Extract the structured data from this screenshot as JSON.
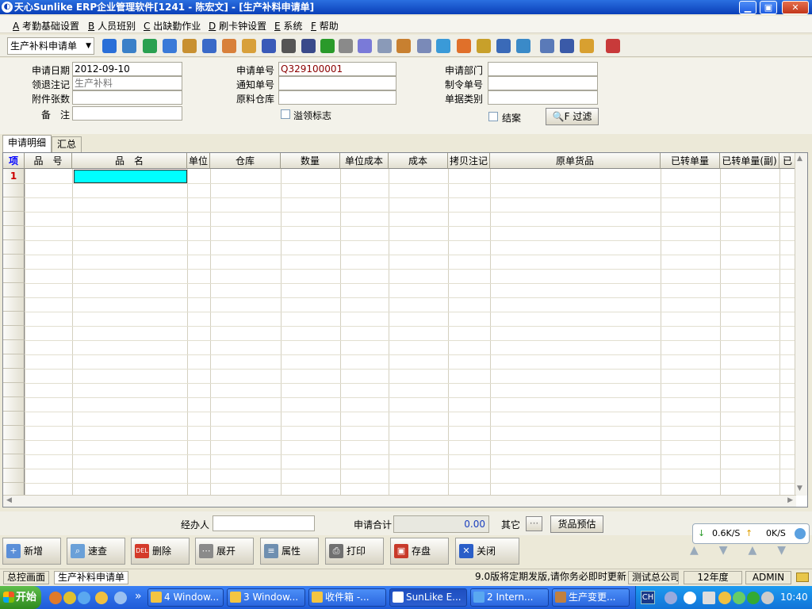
{
  "window": {
    "title": "天心Sunlike ERP企业管理软件[1241 - 陈宏文] - [生产补料申请单]"
  },
  "menu": [
    {
      "key": "A",
      "label": "考勤基础设置"
    },
    {
      "key": "B",
      "label": "人员班别"
    },
    {
      "key": "C",
      "label": "出缺勤作业"
    },
    {
      "key": "D",
      "label": "刷卡钟设置"
    },
    {
      "key": "E",
      "label": "系统"
    },
    {
      "key": "F",
      "label": "帮助"
    }
  ],
  "toolbar": {
    "doc_select": "生产补料申请单",
    "icons": [
      "user-icon",
      "monitor-icon",
      "phone-icon",
      "home-lock-icon",
      "briefcase-icon",
      "house-icon",
      "people-icon",
      "mail-icon",
      "bookmark-icon",
      "key-icon",
      "help-icon",
      "dollar-icon",
      "cart-icon",
      "refresh-icon",
      "calculator-icon",
      "archive-icon",
      "copy-icon",
      "check-icon",
      "flame-icon",
      "tree-icon",
      "chart-icon",
      "sync-icon",
      "window-icon",
      "close-icon",
      "tile-icon",
      "exit-icon"
    ]
  },
  "form": {
    "apply_date_label": "申请日期",
    "apply_date": "2012-09-10",
    "apply_no_label": "申请单号",
    "apply_no": "Q329100001",
    "dept_label": "申请部门",
    "dept": "",
    "remark_label": "领退注记",
    "remark": "生产补料",
    "notice_label": "通知单号",
    "notice": "",
    "order_label": "制令单号",
    "order": "",
    "attach_label": "附件张数",
    "attach": "",
    "warehouse_label": "原料仓库",
    "warehouse": "",
    "doctype_label": "单据类别",
    "doctype": "",
    "note_label": "备　注",
    "note": "",
    "overflow_label": "溢领标志",
    "closed_label": "结案",
    "filter_button": "F 过滤"
  },
  "tabs": [
    "申请明细",
    "汇总"
  ],
  "grid": {
    "columns": [
      "项",
      "品　号",
      "品　名",
      "单位",
      "仓库",
      "数量",
      "单位成本",
      "成本",
      "拷贝注记",
      "原单货品",
      "已转单量",
      "已转单量(副)",
      "已"
    ],
    "first_row_number": "1"
  },
  "summary": {
    "handler_label": "经办人",
    "handler": "",
    "total_label": "申请合计",
    "total": "0.00",
    "other_label": "其它",
    "estimate_button": "货品预估"
  },
  "actions": [
    "新增",
    "速查",
    "删除",
    "展开",
    "属性",
    "打印",
    "存盘",
    "关闭"
  ],
  "network": {
    "down": "0.6K/S",
    "up": "0K/S"
  },
  "statusbar": [
    "总控画面",
    "生产补料申请单",
    "9.0版将定期发版,请你务必即时更新",
    "测试总公司",
    "12年度",
    "ADMIN"
  ],
  "taskbar": {
    "start": "开始",
    "tasks": [
      "4 Window...",
      "3 Window...",
      "收件箱 -...",
      "SunLike E...",
      "2 Intern...",
      "生产变更..."
    ],
    "lang": "CH",
    "time": "10:40"
  }
}
